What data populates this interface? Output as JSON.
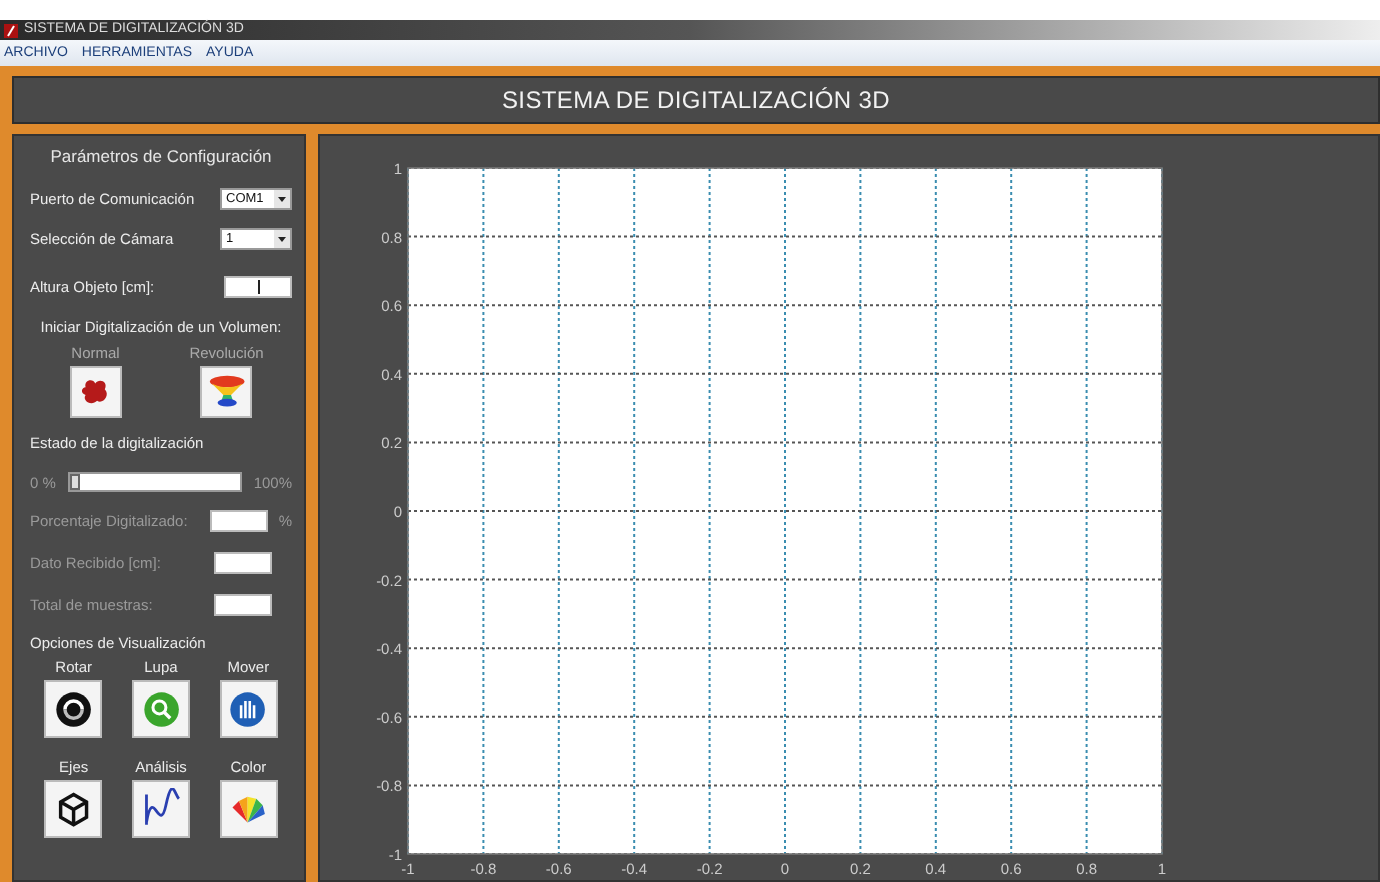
{
  "window": {
    "title": "SISTEMA DE DIGITALIZACIÓN 3D"
  },
  "menu": [
    "ARCHIVO",
    "HERRAMIENTAS",
    "AYUDA"
  ],
  "header": {
    "title": "SISTEMA DE DIGITALIZACIÓN 3D"
  },
  "config": {
    "title": "Parámetros de Configuración",
    "fields": [
      {
        "label": "Puerto de Comunicación",
        "kind": "select",
        "value": "COM1"
      },
      {
        "label": "Selección de Cámara",
        "kind": "select",
        "value": "1"
      },
      {
        "label": "Altura Objeto [cm]:",
        "kind": "text"
      }
    ]
  },
  "scan": {
    "title": "Iniciar Digitalización de un Volumen:",
    "buttons": [
      "Normal",
      "Revolución"
    ]
  },
  "status": {
    "title": "Estado de la digitalización",
    "min_label": "0 %",
    "max_label": "100%",
    "level": 0,
    "readouts": [
      {
        "label": "Porcentaje Digitalizado:",
        "unit": "%"
      },
      {
        "label": "Dato Recibido [cm]:"
      },
      {
        "label": "Total de muestras:"
      }
    ]
  },
  "view": {
    "title": "Opciones de Visualización",
    "tools": [
      "Rotar",
      "Lupa",
      "Mover",
      "Ejes",
      "Análisis",
      "Color"
    ]
  },
  "plot": {
    "chart_data": {
      "type": "line",
      "grid": true,
      "xlim": [
        -1,
        1
      ],
      "ylim": [
        -1,
        1
      ],
      "xticks": [
        -1,
        {
          "value": -0.8,
          "label": "-0.8"
        },
        {
          "value": -0.6,
          "label": "-0.6"
        },
        {
          "value": -0.4,
          "label": "-0.4"
        },
        {
          "value": -0.2,
          "label": "-0.2"
        },
        0,
        0.2,
        0.4,
        0.6,
        0.8,
        1
      ],
      "yticks": [
        -1,
        {
          "value": -0.8,
          "label": "-0.8"
        },
        {
          "value": -0.6,
          "label": "-0.6"
        },
        {
          "value": -0.4,
          "label": "-0.4"
        },
        {
          "value": -0.2,
          "label": "-0.2"
        },
        0,
        0.2,
        0.4,
        0.6,
        0.8,
        1
      ]
    }
  }
}
